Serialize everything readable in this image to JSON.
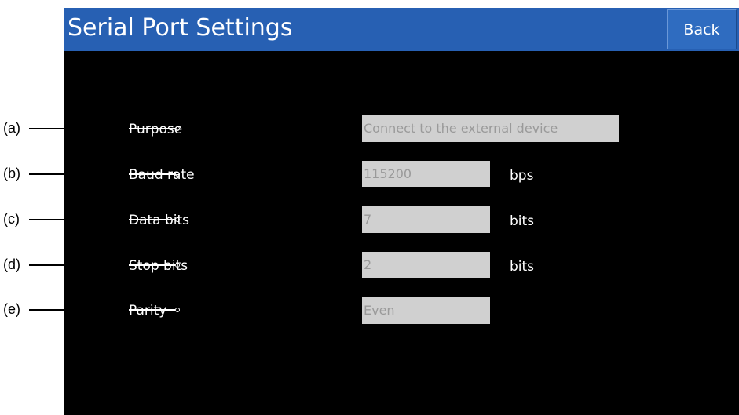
{
  "header": {
    "title": "Serial Port Settings",
    "back_label": "Back"
  },
  "fields": [
    {
      "callout": "(a)",
      "label": "Purpose",
      "value": "Connect to the external device",
      "unit": ""
    },
    {
      "callout": "(b)",
      "label": "Baud rate",
      "value": "115200",
      "unit": "bps"
    },
    {
      "callout": "(c)",
      "label": "Data bits",
      "value": "7",
      "unit": "bits"
    },
    {
      "callout": "(d)",
      "label": "Stop bits",
      "value": "2",
      "unit": "bits"
    },
    {
      "callout": "(e)",
      "label": "Parity",
      "value": "Even",
      "unit": ""
    }
  ],
  "colors": {
    "title_bar": "#2760b3",
    "screen_background": "#000000",
    "field_background": "#d0d0d0",
    "field_text": "#9a9a9a"
  }
}
